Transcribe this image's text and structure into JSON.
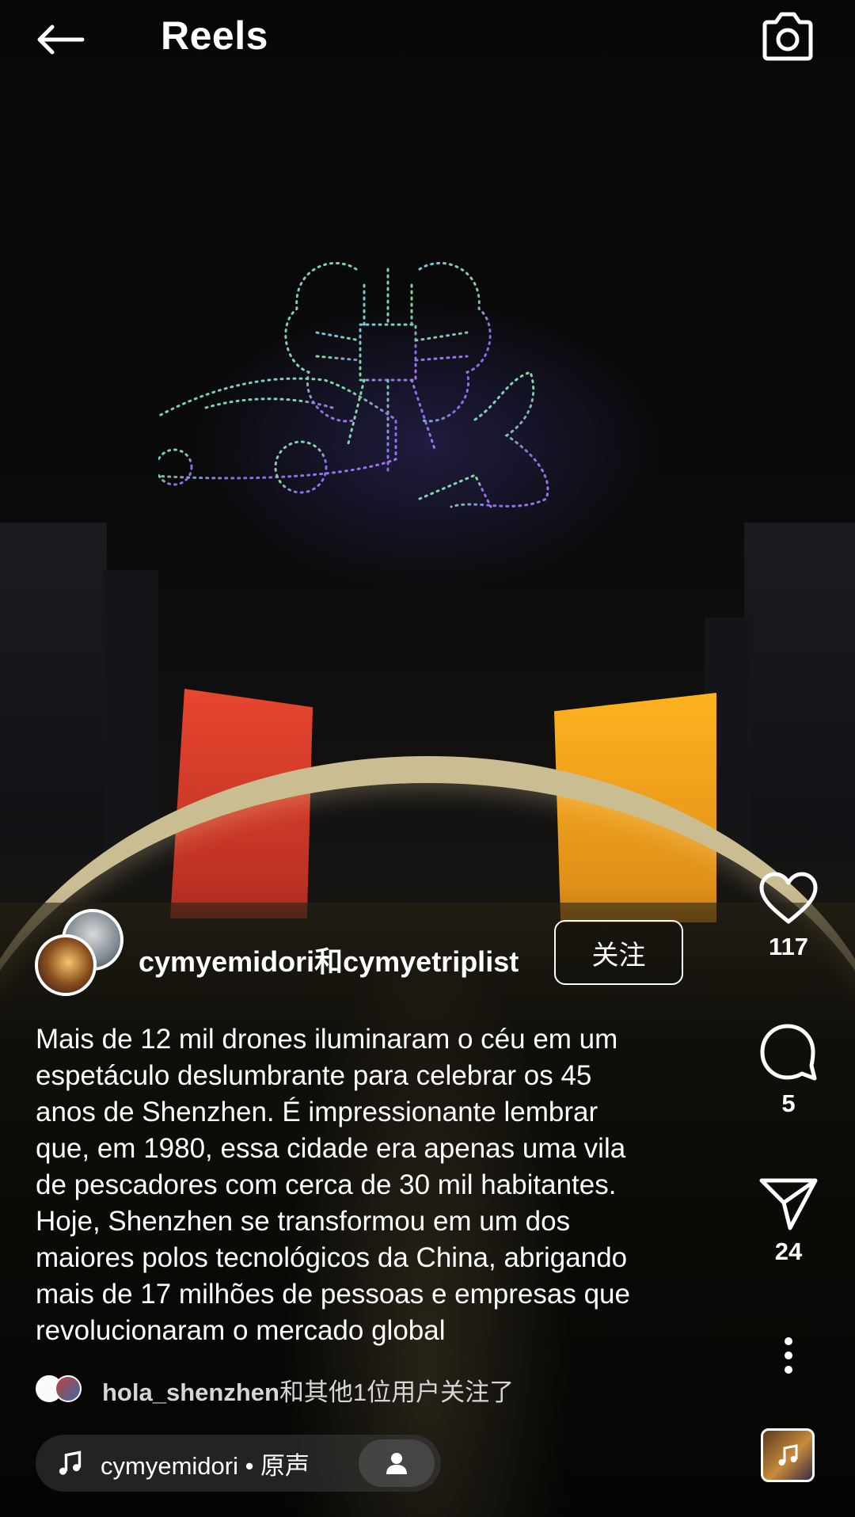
{
  "header": {
    "title": "Reels"
  },
  "post": {
    "authors_line": "cymyemidori和cymyetriplist",
    "follow_label": "关注",
    "caption": "Mais de 12 mil drones iluminaram o céu em um\nespetáculo deslumbrante para celebrar os 45\nanos de Shenzhen. É impressionante lembrar\nque, em 1980, essa cidade era apenas uma vila\nde pescadores com cerca de 30 mil habitantes.\nHoje, Shenzhen se transformou em um dos\nmaiores polos tecnológicos da China, abrigando\nmais de 17 milhões de pessoas e empresas que\nrevolucionaram o mercado global",
    "followed_by_user": "hola_shenzhen",
    "followed_by_rest": "和其他1位用户关注了",
    "audio_label": "cymyemidori • 原声"
  },
  "actions": {
    "likes": "117",
    "comments": "5",
    "shares": "24"
  },
  "icons": {
    "back": "arrow-left-icon",
    "camera": "camera-icon",
    "like": "heart-icon",
    "comment": "comment-bubble-icon",
    "share": "paper-plane-icon",
    "more": "more-vertical-icon",
    "music": "music-note-icon",
    "tagged_people": "person-icon"
  }
}
